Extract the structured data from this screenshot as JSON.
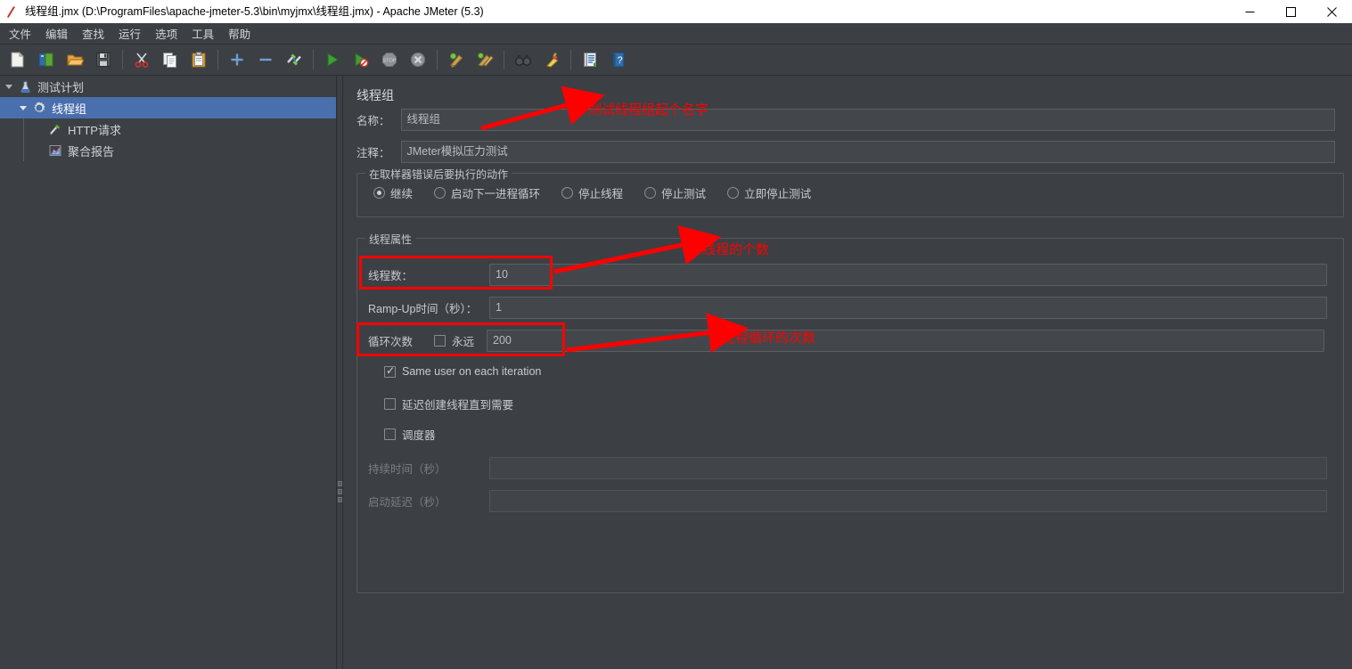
{
  "window": {
    "title": "线程组.jmx (D:\\ProgramFiles\\apache-jmeter-5.3\\bin\\myjmx\\线程组.jmx) - Apache JMeter (5.3)",
    "app_icon": "jmeter-feather-icon",
    "minimize": "—",
    "maximize": "□",
    "close": "✕"
  },
  "menu": {
    "items": [
      {
        "label": "文件"
      },
      {
        "label": "编辑"
      },
      {
        "label": "查找"
      },
      {
        "label": "运行"
      },
      {
        "label": "选项"
      },
      {
        "label": "工具"
      },
      {
        "label": "帮助"
      }
    ]
  },
  "toolbar": {
    "buttons": [
      {
        "name": "new-icon",
        "title": "新建"
      },
      {
        "name": "templates-icon",
        "title": "模板"
      },
      {
        "name": "open-icon",
        "title": "打开"
      },
      {
        "name": "save-icon",
        "title": "保存"
      },
      {
        "name": "cut-icon",
        "title": "剪切"
      },
      {
        "name": "copy-icon",
        "title": "复制"
      },
      {
        "name": "paste-icon",
        "title": "粘贴"
      },
      {
        "name": "expand-all-icon",
        "title": "展开全部"
      },
      {
        "name": "collapse-all-icon",
        "title": "收起全部"
      },
      {
        "name": "toggle-icon",
        "title": "启用/禁用"
      },
      {
        "name": "start-icon",
        "title": "启动"
      },
      {
        "name": "start-no-timers-icon",
        "title": "无间隔启动"
      },
      {
        "name": "stop-icon",
        "title": "停止"
      },
      {
        "name": "shutdown-icon",
        "title": "关闭"
      },
      {
        "name": "clear-icon",
        "title": "清除"
      },
      {
        "name": "clear-all-icon",
        "title": "清除全部"
      },
      {
        "name": "search-icon",
        "title": "查找"
      },
      {
        "name": "reset-search-icon",
        "title": "重置查找"
      },
      {
        "name": "function-helper-icon",
        "title": "函数助手对话框"
      },
      {
        "name": "help-icon",
        "title": "帮助"
      }
    ]
  },
  "tree": {
    "nodes": [
      {
        "label": "测试计划",
        "icon": "test-plan-icon",
        "depth": 0,
        "expanded": true,
        "selected": false
      },
      {
        "label": "线程组",
        "icon": "thread-group-gear-icon",
        "depth": 1,
        "expanded": true,
        "selected": true
      },
      {
        "label": "HTTP请求",
        "icon": "http-request-icon",
        "depth": 2,
        "expanded": false,
        "selected": false
      },
      {
        "label": "聚合报告",
        "icon": "aggregate-report-icon",
        "depth": 2,
        "expanded": false,
        "selected": false
      }
    ]
  },
  "form": {
    "panel_title": "线程组",
    "name_label": "名称：",
    "name_value": "线程组",
    "comment_label": "注释：",
    "comment_value": "JMeter模拟压力测试",
    "error_action": {
      "group_title": "在取样器错误后要执行的动作",
      "options": [
        {
          "label": "继续",
          "selected": true
        },
        {
          "label": "启动下一进程循环",
          "selected": false
        },
        {
          "label": "停止线程",
          "selected": false
        },
        {
          "label": "停止测试",
          "selected": false
        },
        {
          "label": "立即停止测试",
          "selected": false
        }
      ]
    },
    "thread_properties": {
      "group_title": "线程属性",
      "threads_label": "线程数：",
      "threads_value": "10",
      "rampup_label": "Ramp-Up时间（秒）：",
      "rampup_value": "1",
      "loops_label": "循环次数",
      "forever_label": "永远",
      "forever_checked": false,
      "loops_value": "200",
      "same_user_label": "Same user on each iteration",
      "same_user_checked": true,
      "delay_create_label": "延迟创建线程直到需要",
      "delay_create_checked": false,
      "scheduler_label": "调度器",
      "scheduler_checked": false,
      "duration_label": "持续时间（秒）",
      "duration_value": "",
      "duration_disabled": true,
      "startup_delay_label": "启动延迟（秒）",
      "startup_delay_value": "",
      "startup_delay_disabled": true
    }
  },
  "annotations": {
    "color": "#ff0000",
    "notes": [
      {
        "text": "测试线程组起个名字"
      },
      {
        "text": "线程的个数"
      },
      {
        "text": "先程循环的次数"
      }
    ]
  },
  "colors": {
    "background": "#3c4044",
    "selection": "#4a6fad",
    "titlebar": "#ffffff",
    "annotation": "#ff0000",
    "text": "#c8cbcd"
  }
}
